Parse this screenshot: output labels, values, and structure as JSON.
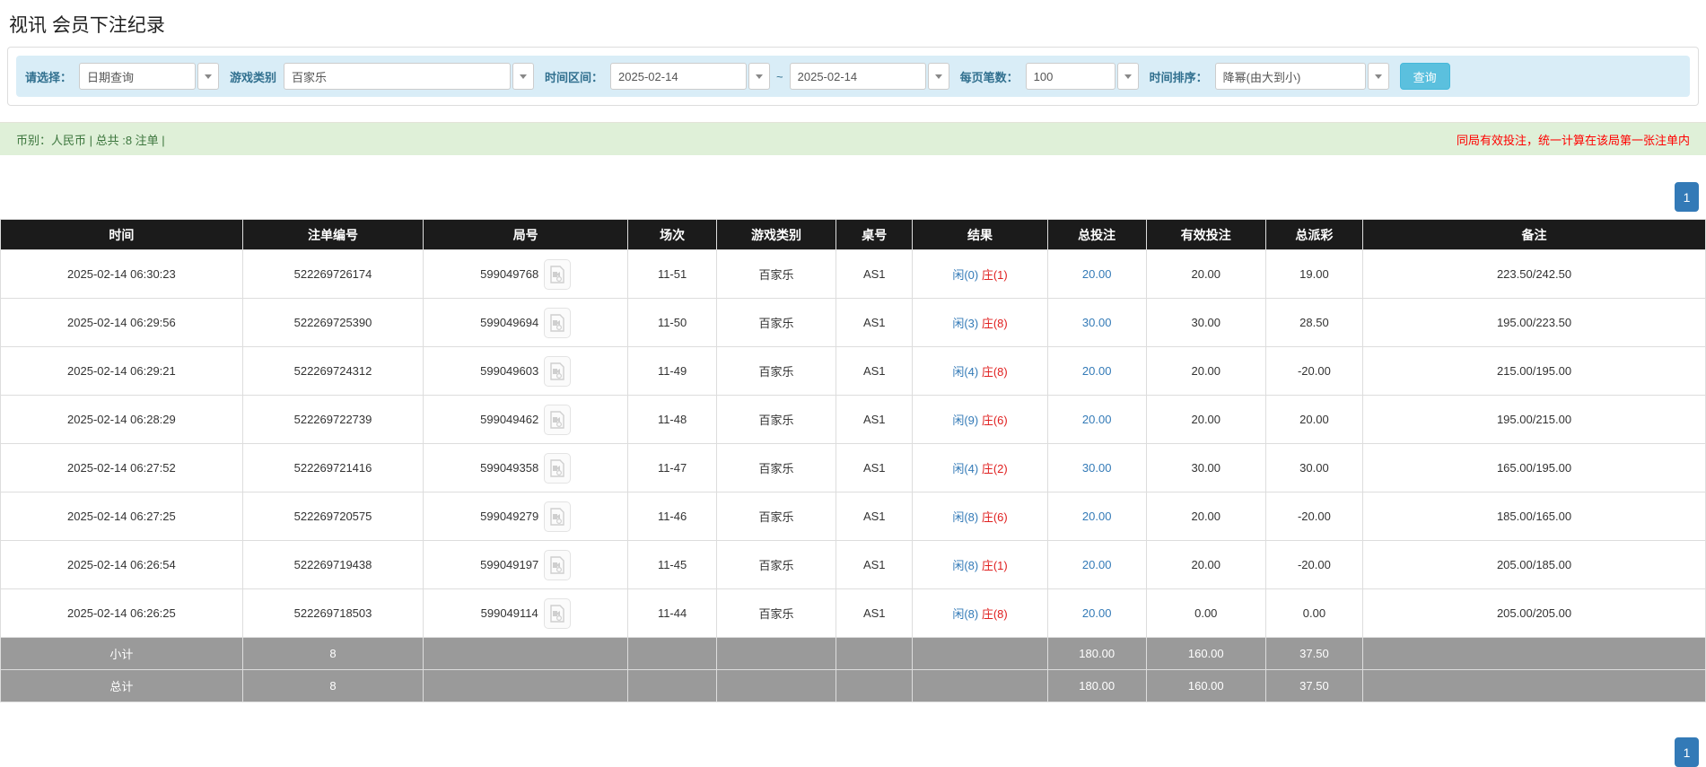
{
  "page": {
    "title": "视讯 会员下注纪录"
  },
  "filters": {
    "select_label": "请选择：",
    "select_value": "日期查询",
    "game_type_label": "游戏类别",
    "game_type_value": "百家乐",
    "time_range_label": "时间区间：",
    "date_from": "2025-02-14",
    "tilde": "~",
    "date_to": "2025-02-14",
    "page_size_label": "每页笔数：",
    "page_size_value": "100",
    "sort_label": "时间排序：",
    "sort_value": "降幂(由大到小)",
    "search_button": "查询"
  },
  "summary_bar": {
    "left_text": "币别：人民币 | 总共 :8 注单 |",
    "right_text": "同局有效投注，统一计算在该局第一张注单内"
  },
  "pagination": {
    "page": "1"
  },
  "table": {
    "headers": [
      "时间",
      "注单编号",
      "局号",
      "场次",
      "游戏类别",
      "桌号",
      "结果",
      "总投注",
      "有效投注",
      "总派彩",
      "备注"
    ],
    "rows": [
      {
        "time": "2025-02-14 06:30:23",
        "bet_id": "522269726174",
        "round_id": "599049768",
        "session": "11-51",
        "game": "百家乐",
        "table_no": "AS1",
        "result_player": "闲(0)",
        "result_banker": "庄(1)",
        "total_bet": "20.00",
        "valid_bet": "20.00",
        "payout": "19.00",
        "note": "223.50/242.50"
      },
      {
        "time": "2025-02-14 06:29:56",
        "bet_id": "522269725390",
        "round_id": "599049694",
        "session": "11-50",
        "game": "百家乐",
        "table_no": "AS1",
        "result_player": "闲(3)",
        "result_banker": "庄(8)",
        "total_bet": "30.00",
        "valid_bet": "30.00",
        "payout": "28.50",
        "note": "195.00/223.50"
      },
      {
        "time": "2025-02-14 06:29:21",
        "bet_id": "522269724312",
        "round_id": "599049603",
        "session": "11-49",
        "game": "百家乐",
        "table_no": "AS1",
        "result_player": "闲(4)",
        "result_banker": "庄(8)",
        "total_bet": "20.00",
        "valid_bet": "20.00",
        "payout": "-20.00",
        "note": "215.00/195.00"
      },
      {
        "time": "2025-02-14 06:28:29",
        "bet_id": "522269722739",
        "round_id": "599049462",
        "session": "11-48",
        "game": "百家乐",
        "table_no": "AS1",
        "result_player": "闲(9)",
        "result_banker": "庄(6)",
        "total_bet": "20.00",
        "valid_bet": "20.00",
        "payout": "20.00",
        "note": "195.00/215.00"
      },
      {
        "time": "2025-02-14 06:27:52",
        "bet_id": "522269721416",
        "round_id": "599049358",
        "session": "11-47",
        "game": "百家乐",
        "table_no": "AS1",
        "result_player": "闲(4)",
        "result_banker": "庄(2)",
        "total_bet": "30.00",
        "valid_bet": "30.00",
        "payout": "30.00",
        "note": "165.00/195.00"
      },
      {
        "time": "2025-02-14 06:27:25",
        "bet_id": "522269720575",
        "round_id": "599049279",
        "session": "11-46",
        "game": "百家乐",
        "table_no": "AS1",
        "result_player": "闲(8)",
        "result_banker": "庄(6)",
        "total_bet": "20.00",
        "valid_bet": "20.00",
        "payout": "-20.00",
        "note": "185.00/165.00"
      },
      {
        "time": "2025-02-14 06:26:54",
        "bet_id": "522269719438",
        "round_id": "599049197",
        "session": "11-45",
        "game": "百家乐",
        "table_no": "AS1",
        "result_player": "闲(8)",
        "result_banker": "庄(1)",
        "total_bet": "20.00",
        "valid_bet": "20.00",
        "payout": "-20.00",
        "note": "205.00/185.00"
      },
      {
        "time": "2025-02-14 06:26:25",
        "bet_id": "522269718503",
        "round_id": "599049114",
        "session": "11-44",
        "game": "百家乐",
        "table_no": "AS1",
        "result_player": "闲(8)",
        "result_banker": "庄(8)",
        "total_bet": "20.00",
        "valid_bet": "0.00",
        "payout": "0.00",
        "note": "205.00/205.00"
      }
    ],
    "subtotal": {
      "label": "小计",
      "count": "8",
      "total_bet": "180.00",
      "valid_bet": "160.00",
      "payout": "37.50"
    },
    "total": {
      "label": "总计",
      "count": "8",
      "total_bet": "180.00",
      "valid_bet": "160.00",
      "payout": "37.50"
    }
  },
  "colors": {
    "link_blue": "#337ab7",
    "player_blue": "#337ab7",
    "banker_red": "#e02020",
    "negative_red": "#ff0000",
    "search_button_bg": "#5bc0de",
    "pagination_bg": "#337ab7",
    "header_bg": "#1b1b1b",
    "summary_row_bg": "#9a9a9a",
    "green_bar_bg": "#dff0d8",
    "filter_bar_bg": "#d9edf7"
  }
}
